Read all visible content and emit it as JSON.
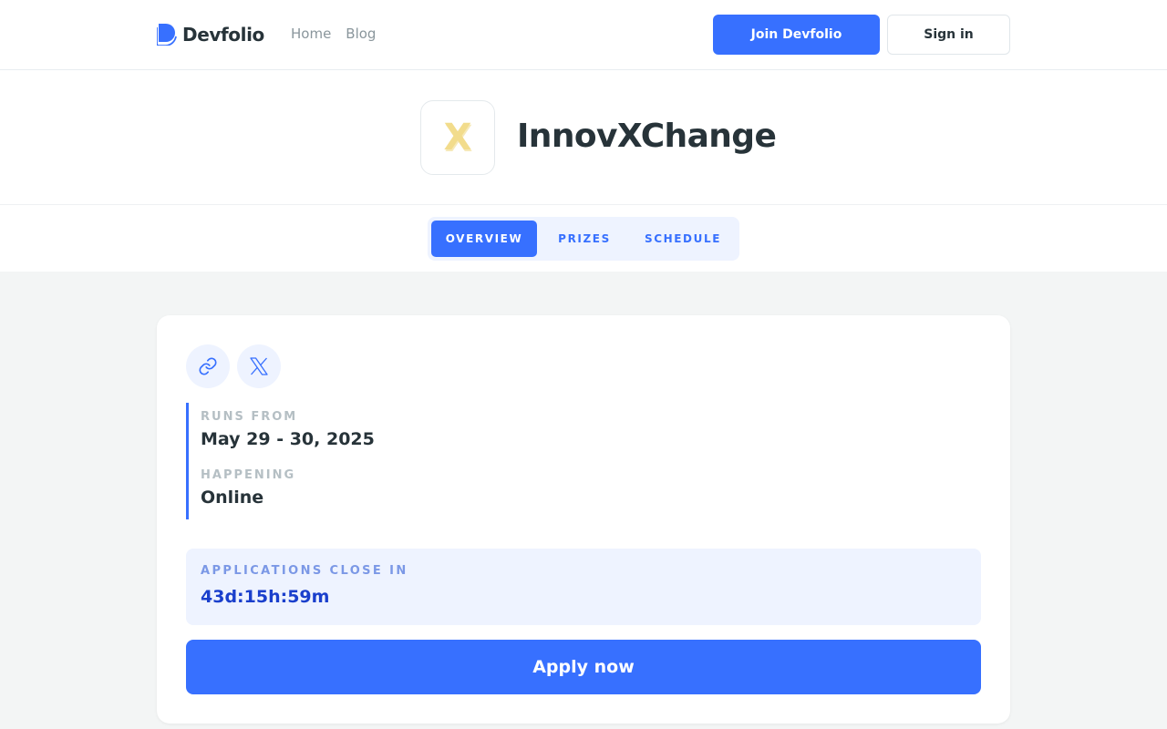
{
  "header": {
    "brand": "Devfolio",
    "nav": [
      "Home",
      "Blog"
    ],
    "join_label": "Join Devfolio",
    "signin_label": "Sign in"
  },
  "event": {
    "logo_letter": "X",
    "name": "InnovXChange"
  },
  "tabs": [
    {
      "label": "OVERVIEW",
      "active": true
    },
    {
      "label": "PRIZES",
      "active": false
    },
    {
      "label": "SCHEDULE",
      "active": false
    }
  ],
  "card": {
    "social_icons": [
      "link-icon",
      "x-icon"
    ],
    "runs_from_label": "RUNS FROM",
    "runs_from_value": "May 29 - 30, 2025",
    "happening_label": "HAPPENING",
    "happening_value": "Online",
    "countdown_label": "APPLICATIONS CLOSE IN",
    "countdown_value": "43d:15h:59m",
    "apply_label": "Apply now"
  },
  "colors": {
    "accent": "#3770FF",
    "accent_light": "#EEF3FF",
    "text_dark": "#273339",
    "text_muted": "#8A969C",
    "background": "#F3F5F5"
  }
}
